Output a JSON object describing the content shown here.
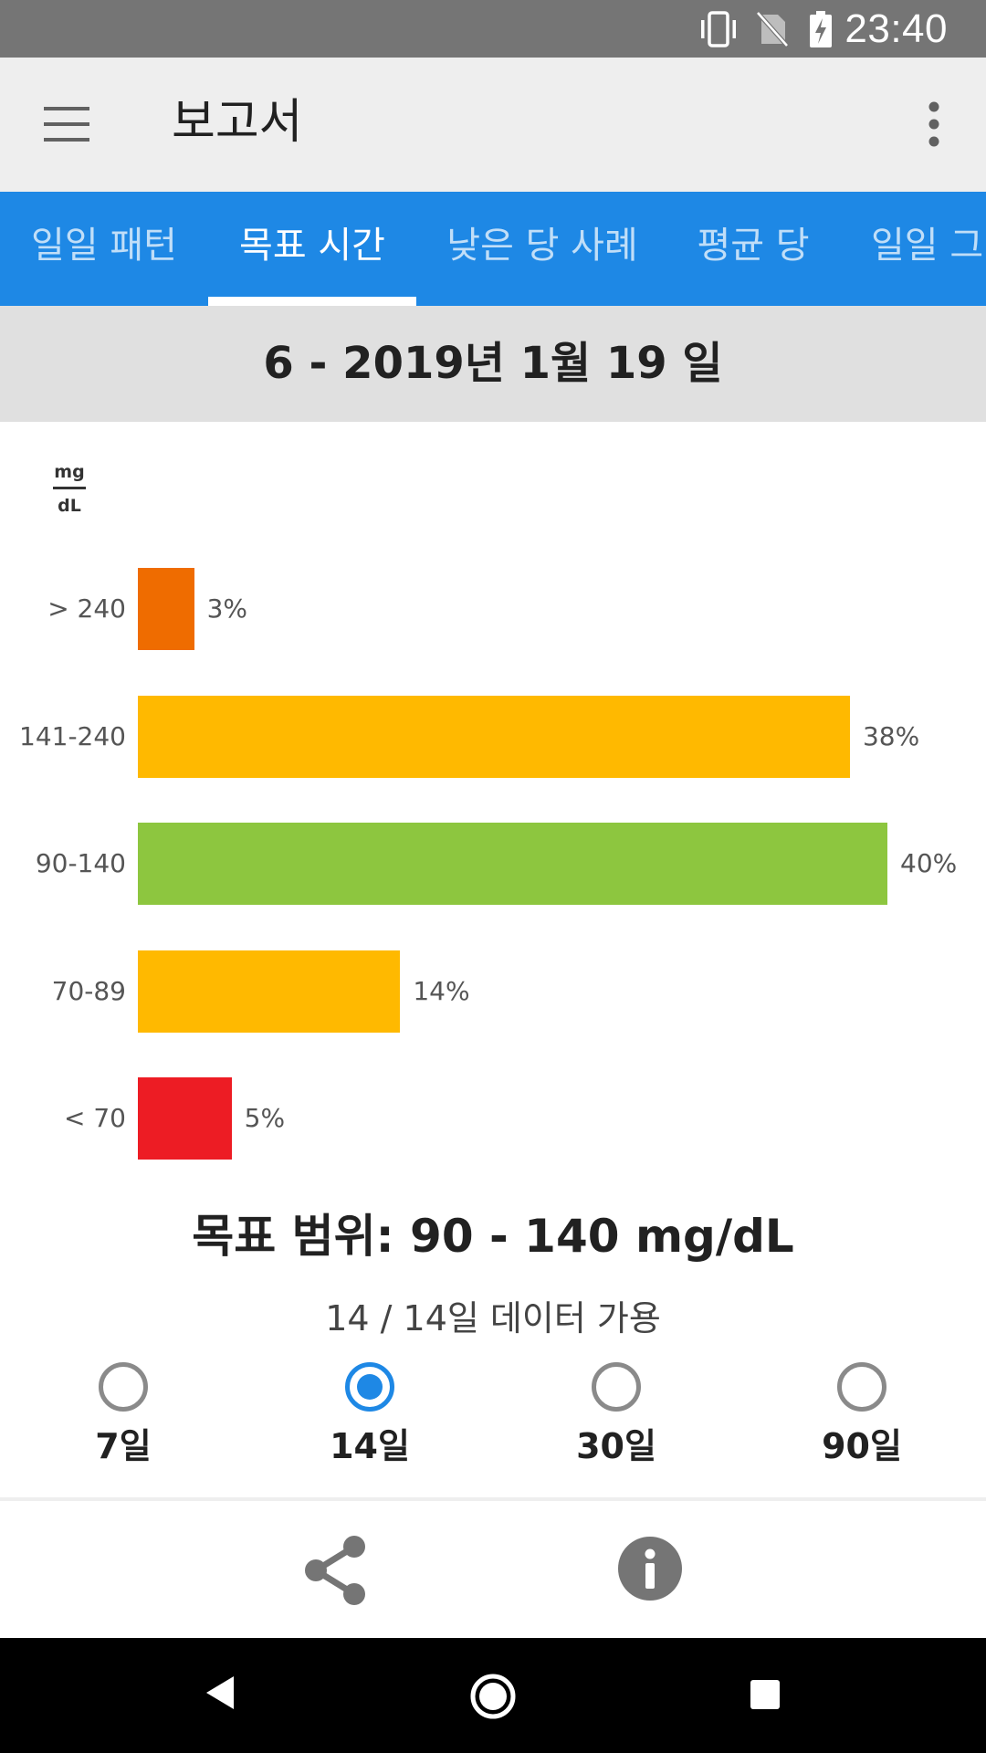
{
  "status_bar": {
    "time": "23:40",
    "icons": [
      "vibrate-icon",
      "no-sim-icon",
      "battery-charging-icon"
    ]
  },
  "app_bar": {
    "title": "보고서",
    "menu_icon": "menu-icon",
    "more_icon": "more-vert-icon"
  },
  "tabs": [
    {
      "label": "일일 패턴",
      "active": false
    },
    {
      "label": "목표 시간",
      "active": true
    },
    {
      "label": "낮은 당 사례",
      "active": false
    },
    {
      "label": "평균 당",
      "active": false
    },
    {
      "label": "일일 그",
      "active": false
    }
  ],
  "date_range": "6 - 2019년 1월 19 일",
  "chart_unit": {
    "top": "mg",
    "bottom": "dL"
  },
  "chart_data": {
    "type": "bar",
    "orientation": "horizontal",
    "categories": [
      "> 240",
      "141-240",
      "90-140",
      "70-89",
      "< 70"
    ],
    "values": [
      3,
      38,
      40,
      14,
      5
    ],
    "value_labels": [
      "3%",
      "38%",
      "40%",
      "14%",
      "5%"
    ],
    "colors": [
      "#ef6c00",
      "#ffb900",
      "#8dc63f",
      "#ffb900",
      "#ed1c24"
    ],
    "unit": "%",
    "xlim": [
      0,
      40
    ]
  },
  "target_range": "목표 범위: 90 - 140 mg/dL",
  "availability": "14 / 14일 데이터 가용",
  "period_options": [
    {
      "label": "7일",
      "selected": false
    },
    {
      "label": "14일",
      "selected": true
    },
    {
      "label": "30일",
      "selected": false
    },
    {
      "label": "90일",
      "selected": false
    }
  ],
  "actions": {
    "share_icon": "share-icon",
    "info_icon": "info-icon"
  },
  "nav_bar": {
    "back_icon": "back-icon",
    "home_icon": "home-icon",
    "recents_icon": "recents-icon"
  }
}
